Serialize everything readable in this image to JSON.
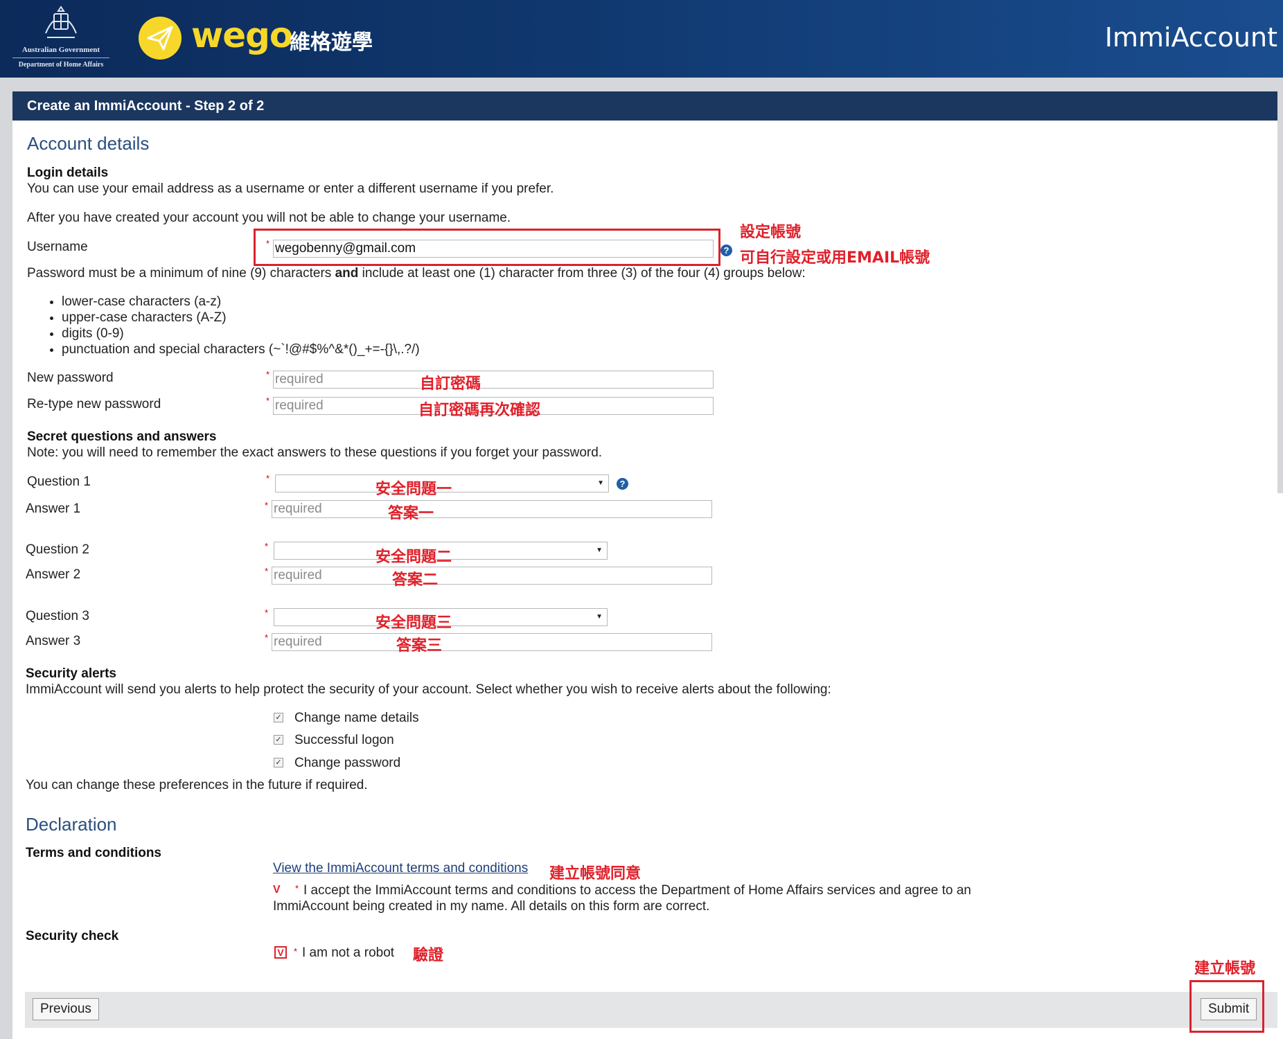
{
  "header": {
    "gov_line1": "Australian Government",
    "gov_line2": "Department of Home Affairs",
    "brand_word": "wego",
    "brand_cn": "維格遊學",
    "app_title": "ImmiAccount",
    "brand_color": "#f7d82a"
  },
  "step_title": "Create an ImmiAccount - Step 2 of 2",
  "account": {
    "heading": "Account details",
    "login_heading": "Login details",
    "login_text1": "You can use your email address as a username or enter a different username if you prefer.",
    "login_text2": "After you have created your account you will not be able to change your username.",
    "username_label": "Username",
    "username_value": "wegobenny@gmail.com",
    "password_rule_prefix": "Password must be a minimum of nine (9) characters ",
    "password_rule_bold": "and",
    "password_rule_suffix": " include at least one (1) character from three (3) of the four (4) groups below:",
    "rules": [
      "lower-case characters (a-z)",
      "upper-case characters (A-Z)",
      "digits (0-9)",
      "punctuation and special characters (~`!@#$%^&*()_+=-{}\\,.?/)"
    ],
    "new_password_label": "New password",
    "retype_password_label": "Re-type new password",
    "required_placeholder": "required"
  },
  "secret": {
    "heading": "Secret questions and answers",
    "note": "Note: you will need to remember the exact answers to these questions if you forget your password.",
    "question1_label": "Question 1",
    "answer1_label": "Answer 1",
    "question2_label": "Question 2",
    "answer2_label": "Answer 2",
    "question3_label": "Question 3",
    "answer3_label": "Answer 3"
  },
  "alerts": {
    "heading": "Security alerts",
    "text": "ImmiAccount will send you alerts to help protect the security of your account. Select whether you wish to receive alerts about the following:",
    "options": [
      "Change name details",
      "Successful logon",
      "Change password"
    ],
    "footer": "You can change these preferences in the future if required."
  },
  "declaration": {
    "heading": "Declaration",
    "terms_heading": "Terms and conditions",
    "terms_link": "View the ImmiAccount terms and conditions",
    "accept_line1": "I accept the ImmiAccount terms and conditions to access the Department of Home Affairs services and agree to an",
    "accept_line2": "ImmiAccount being created in my name. All details on this form are correct.",
    "security_check_heading": "Security check",
    "robot_label": "I am not a robot"
  },
  "annotations": {
    "set_account": "設定帳號",
    "custom_or_email": "可自行設定或用EMAIL帳號",
    "custom_password": "自訂密碼",
    "confirm_password": "自訂密碼再次確認",
    "question1": "安全問題一",
    "answer1": "答案一",
    "question2": "安全問題二",
    "answer2": "答案二",
    "question3": "安全問題三",
    "answer3": "答案三",
    "agree": "建立帳號同意",
    "verify": "驗證",
    "create_account": "建立帳號",
    "annotation_color": "#e0202a"
  },
  "footer": {
    "previous_label": "Previous",
    "submit_label": "Submit"
  }
}
